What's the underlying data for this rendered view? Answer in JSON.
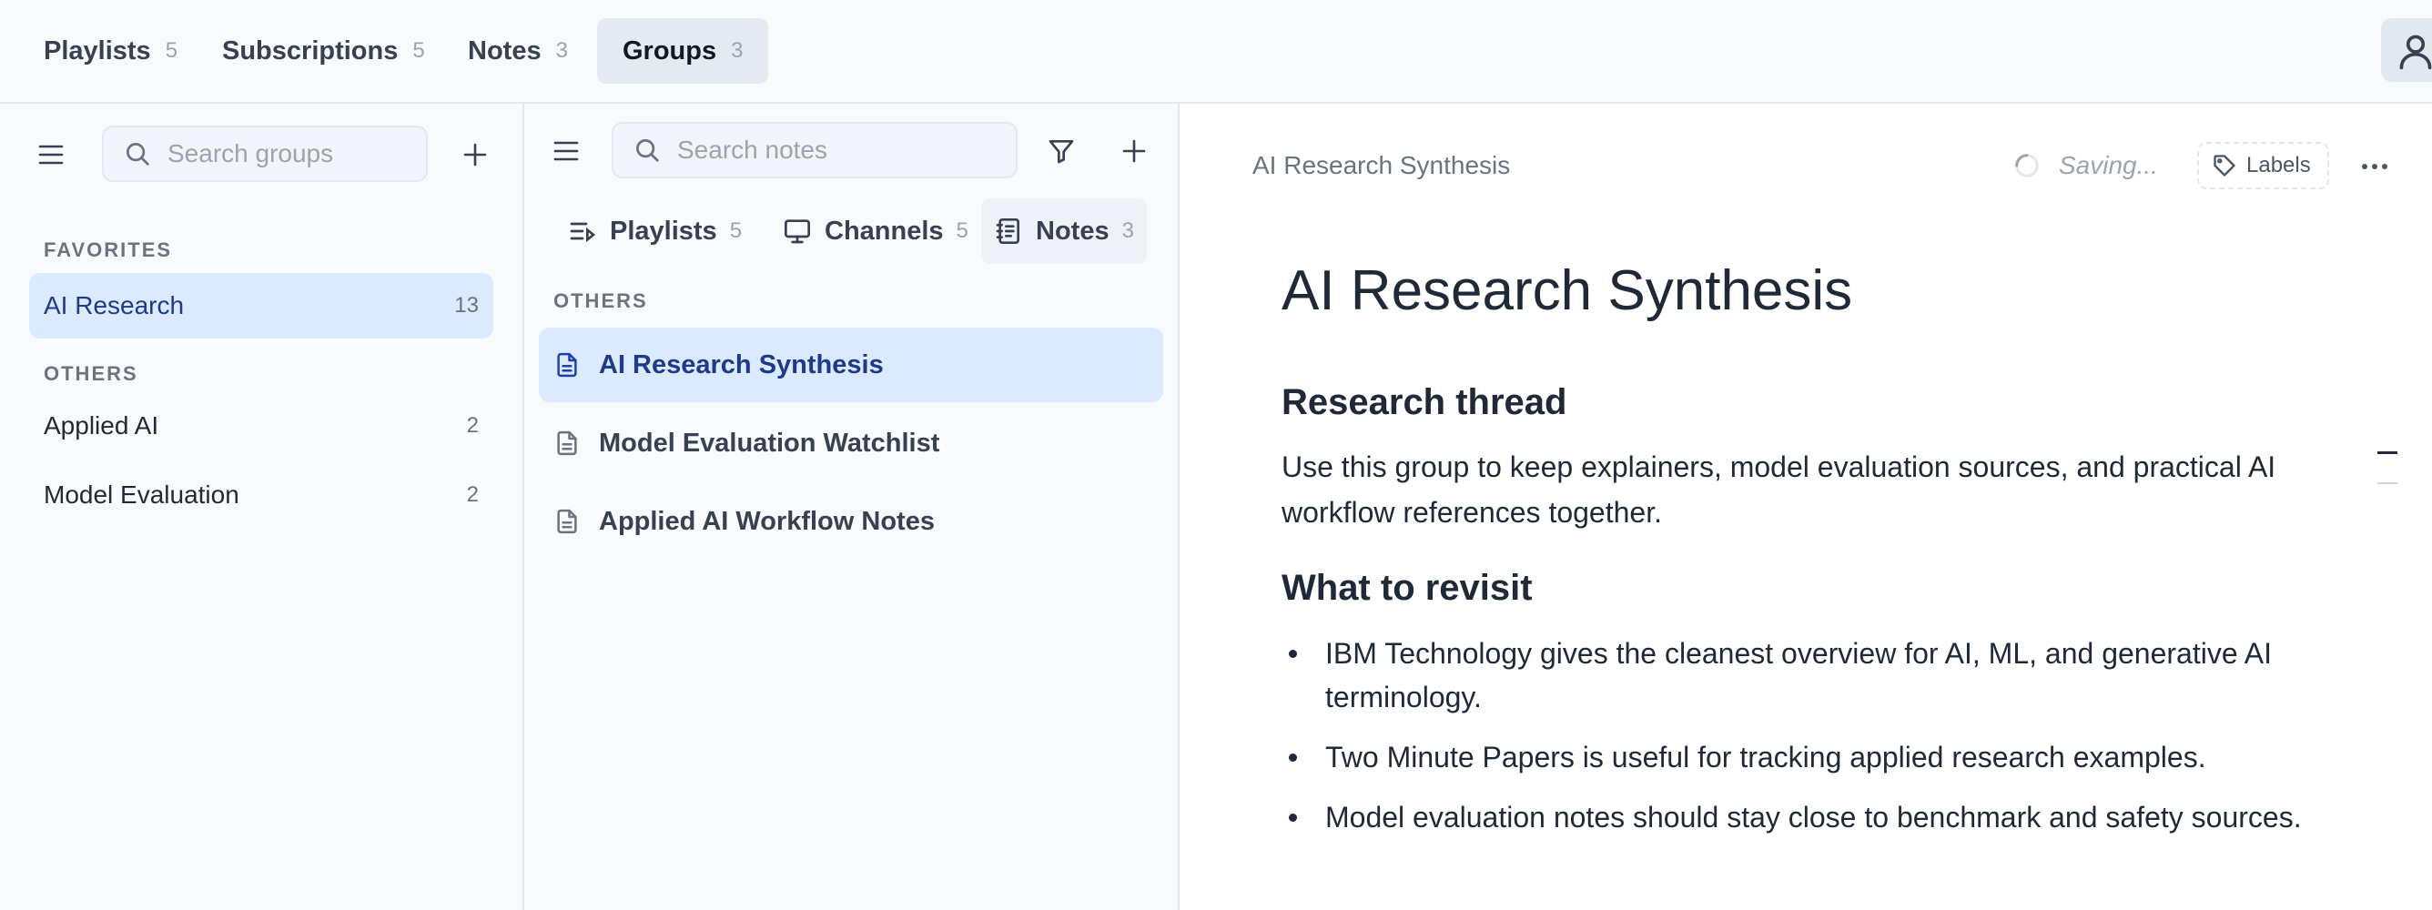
{
  "top_tabs": [
    {
      "label": "Playlists",
      "count": "5"
    },
    {
      "label": "Subscriptions",
      "count": "5"
    },
    {
      "label": "Notes",
      "count": "3"
    },
    {
      "label": "Groups",
      "count": "3"
    }
  ],
  "groups_panel": {
    "search_placeholder": "Search groups",
    "favorites_label": "FAVORITES",
    "favorites": [
      {
        "name": "AI Research",
        "count": "13"
      }
    ],
    "others_label": "OTHERS",
    "others": [
      {
        "name": "Applied AI",
        "count": "2"
      },
      {
        "name": "Model Evaluation",
        "count": "2"
      }
    ]
  },
  "notes_panel": {
    "search_placeholder": "Search notes",
    "tabs": [
      {
        "label": "Playlists",
        "count": "5",
        "icon": "playlist-icon"
      },
      {
        "label": "Channels",
        "count": "5",
        "icon": "monitor-icon"
      },
      {
        "label": "Notes",
        "count": "3",
        "icon": "notebook-icon"
      }
    ],
    "section_label": "OTHERS",
    "notes": [
      {
        "title": "AI Research Synthesis"
      },
      {
        "title": "Model Evaluation Watchlist"
      },
      {
        "title": "Applied AI Workflow Notes"
      }
    ]
  },
  "editor": {
    "breadcrumb": "AI Research Synthesis",
    "status": "Saving...",
    "labels_button": "Labels",
    "title": "AI Research Synthesis",
    "section1_heading": "Research thread",
    "section1_text": "Use this group to keep explainers, model evaluation sources, and practical AI workflow references together.",
    "section2_heading": "What to revisit",
    "bullets": [
      "IBM Technology gives the cleanest overview for AI, ML, and generative AI terminology.",
      "Two Minute Papers is useful for tracking applied research examples.",
      "Model evaluation notes should stay close to benchmark and safety sources."
    ]
  },
  "colors": {
    "accent_bg": "#dbeafe",
    "accent_text": "#1e3a8a",
    "panel_bg": "#f8fafc"
  }
}
